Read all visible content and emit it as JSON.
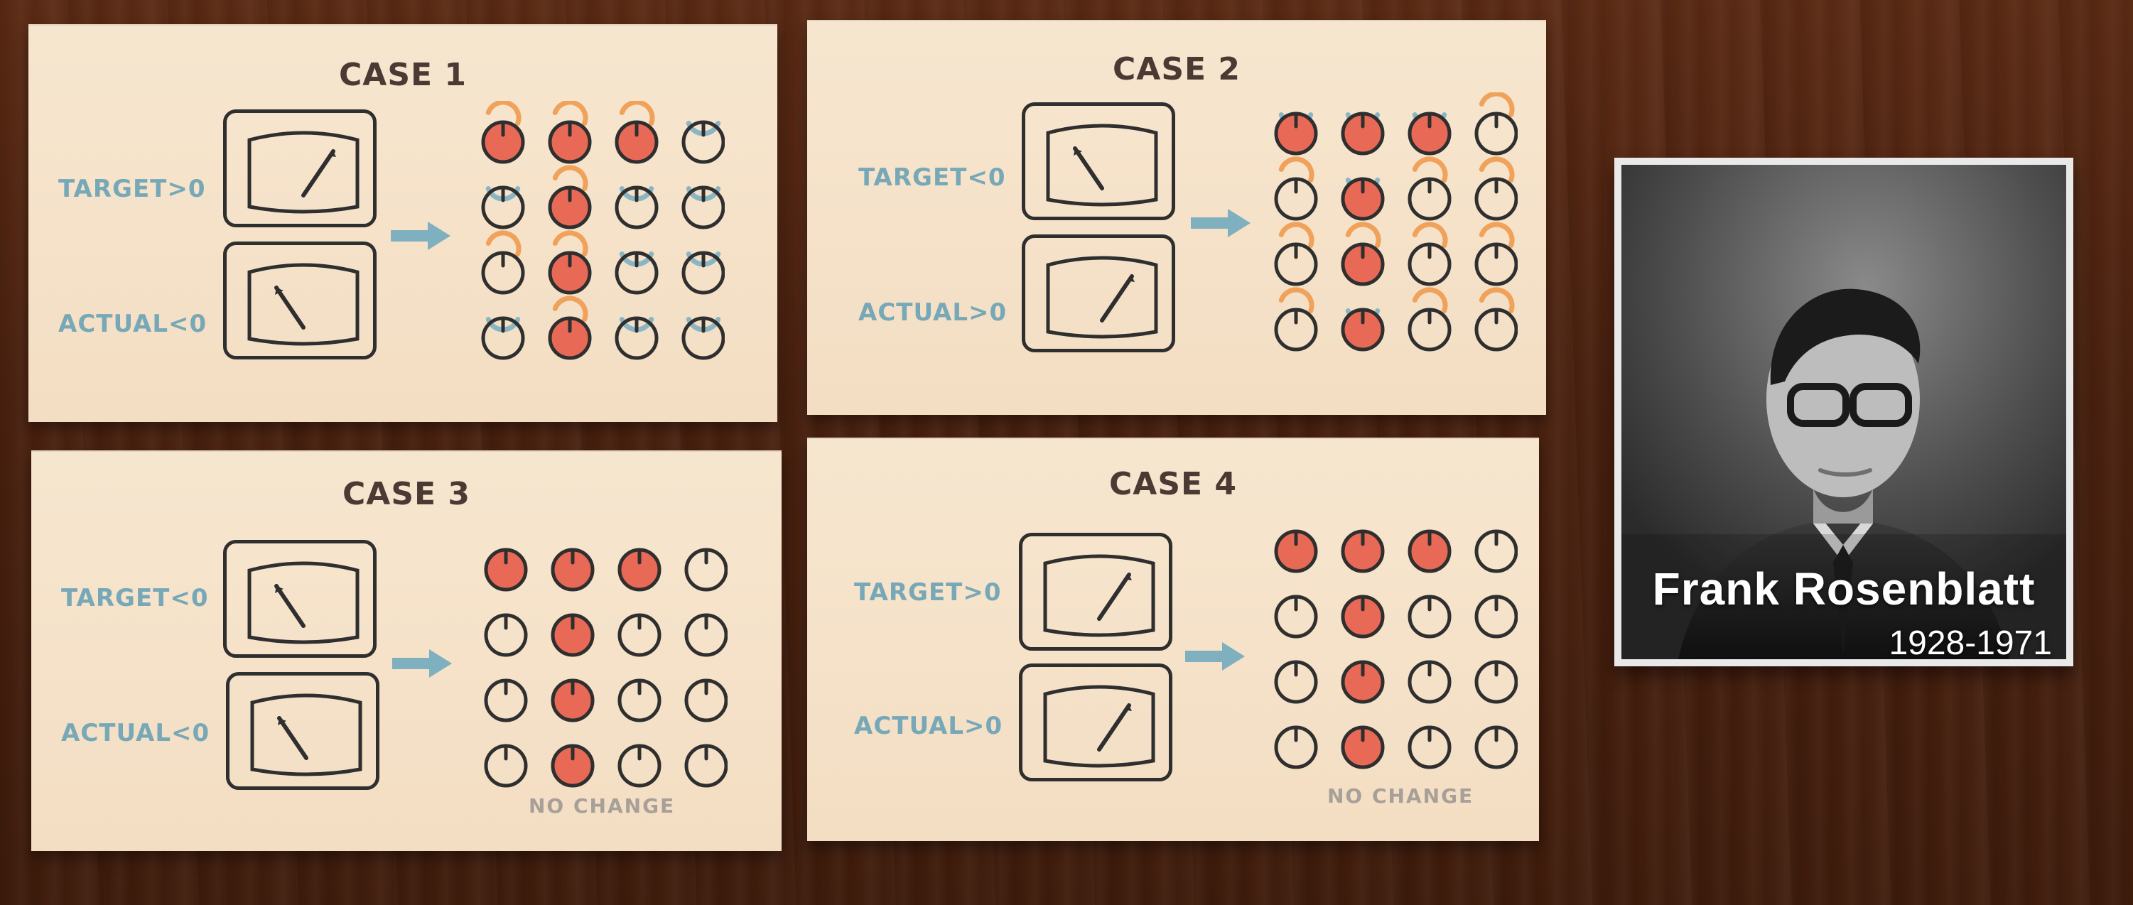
{
  "cases": [
    {
      "title": "CASE 1",
      "target_label": "TARGET>0",
      "actual_label": "ACTUAL<0",
      "note": "",
      "dial_states": [
        [
          "red",
          "red",
          "red",
          "white"
        ],
        [
          "white",
          "red",
          "white",
          "white"
        ],
        [
          "white",
          "red",
          "white",
          "white"
        ],
        [
          "white",
          "red",
          "white",
          "white"
        ]
      ],
      "rotation_marks": [
        [
          "orange",
          "orange",
          "orange",
          "blue"
        ],
        [
          "blue",
          "orange",
          "blue",
          "blue"
        ],
        [
          "orange",
          "orange",
          "blue",
          "blue"
        ],
        [
          "blue",
          "orange",
          "blue",
          "blue"
        ]
      ]
    },
    {
      "title": "CASE 2",
      "target_label": "TARGET<0",
      "actual_label": "ACTUAL>0",
      "note": "",
      "dial_states": [
        [
          "red",
          "red",
          "red",
          "white"
        ],
        [
          "white",
          "red",
          "white",
          "white"
        ],
        [
          "white",
          "red",
          "white",
          "white"
        ],
        [
          "white",
          "red",
          "white",
          "white"
        ]
      ],
      "rotation_marks": [
        [
          "blue",
          "blue",
          "blue",
          "orange"
        ],
        [
          "orange",
          "blue",
          "orange",
          "orange"
        ],
        [
          "orange",
          "orange",
          "orange",
          "orange"
        ],
        [
          "orange",
          "blue",
          "orange",
          "orange"
        ]
      ]
    },
    {
      "title": "CASE 3",
      "target_label": "TARGET<0",
      "actual_label": "ACTUAL<0",
      "note": "NO CHANGE",
      "dial_states": [
        [
          "red",
          "red",
          "red",
          "white"
        ],
        [
          "white",
          "red",
          "white",
          "white"
        ],
        [
          "white",
          "red",
          "white",
          "white"
        ],
        [
          "white",
          "red",
          "white",
          "white"
        ]
      ],
      "rotation_marks": null
    },
    {
      "title": "CASE 4",
      "target_label": "TARGET>0",
      "actual_label": "ACTUAL>0",
      "note": "NO CHANGE",
      "dial_states": [
        [
          "red",
          "red",
          "red",
          "white"
        ],
        [
          "white",
          "red",
          "white",
          "white"
        ],
        [
          "white",
          "red",
          "white",
          "white"
        ],
        [
          "white",
          "red",
          "white",
          "white"
        ]
      ],
      "rotation_marks": null
    }
  ],
  "photo": {
    "name": "Frank Rosenblatt",
    "years": "1928-1971"
  },
  "colors": {
    "card": "#f6e3cc",
    "label_blue": "#77a8b7",
    "title_dark": "#4a3a33",
    "arrow_blue": "#7fb0bf",
    "dial_red": "#e86a56",
    "mark_orange": "#f0a25a",
    "mark_blue": "#8ab6c4"
  },
  "icons": {
    "meter": "analog-meter-icon",
    "arrow": "right-arrow-icon",
    "dial": "knob-icon"
  }
}
